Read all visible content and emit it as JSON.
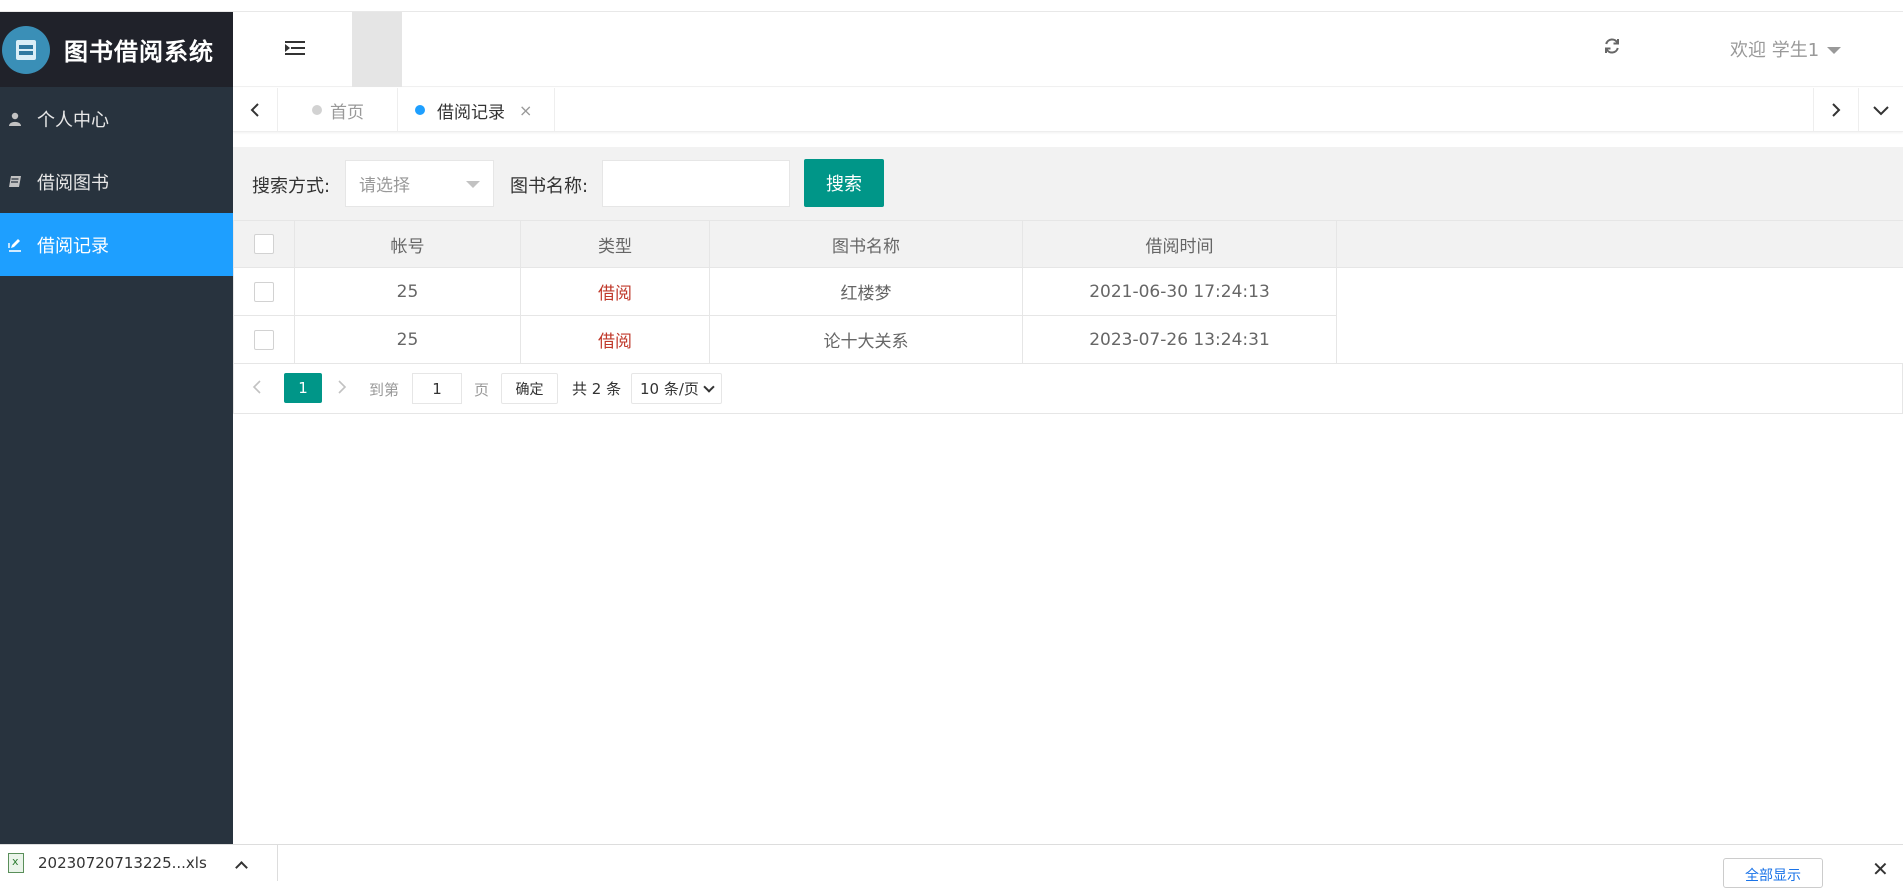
{
  "app": {
    "title": "图书借阅系统"
  },
  "sidebar": {
    "items": [
      {
        "label": "个人中心",
        "icon": "user-icon"
      },
      {
        "label": "借阅图书",
        "icon": "book-icon"
      },
      {
        "label": "借阅记录",
        "icon": "edit-icon",
        "active": true
      }
    ]
  },
  "header": {
    "refresh_icon": "refresh-icon",
    "welcome": "欢迎 学生1"
  },
  "tabs": {
    "items": [
      {
        "label": "首页"
      },
      {
        "label": "借阅记录",
        "closable": true
      }
    ],
    "close_glyph": "×"
  },
  "search": {
    "method_label": "搜索方式:",
    "method_placeholder": "请选择",
    "name_label": "图书名称:",
    "name_value": "",
    "button": "搜索"
  },
  "table": {
    "columns": [
      "帐号",
      "类型",
      "图书名称",
      "借阅时间"
    ],
    "rows": [
      {
        "account": "25",
        "type": "借阅",
        "book": "红楼梦",
        "time": "2021-06-30 17:24:13"
      },
      {
        "account": "25",
        "type": "借阅",
        "book": "论十大关系",
        "time": "2023-07-26 13:24:31"
      }
    ]
  },
  "pager": {
    "current": "1",
    "goto_label": "到第",
    "goto_value": "1",
    "page_label": "页",
    "confirm": "确定",
    "total": "共 2 条",
    "page_size": "10 条/页"
  },
  "download": {
    "filename": "20230720713225...xls",
    "show_all": "全部显示"
  },
  "colors": {
    "sidebar_bg": "#28333e",
    "active_nav": "#1e9fff",
    "primary": "#009688",
    "type_text": "#c0392b"
  }
}
